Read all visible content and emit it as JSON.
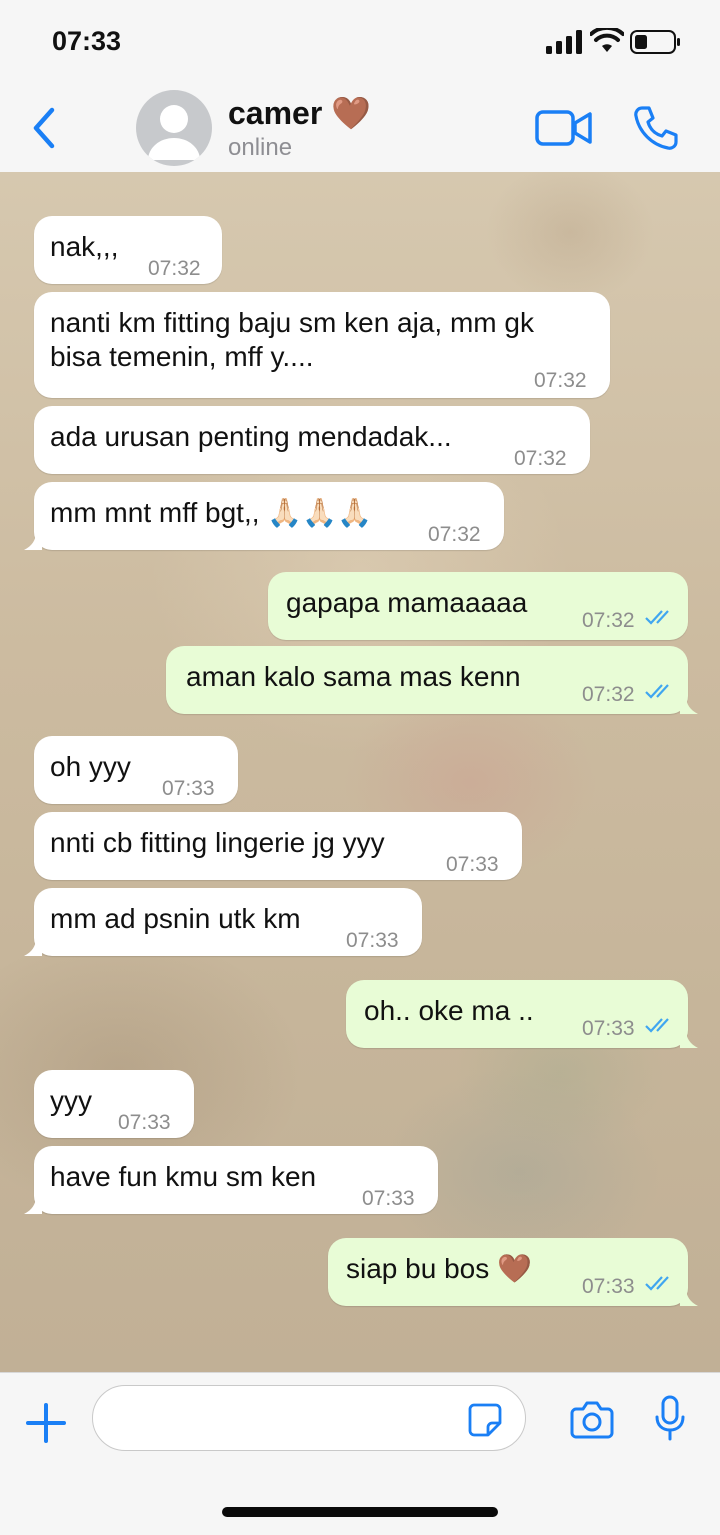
{
  "status_bar": {
    "time": "07:33"
  },
  "header": {
    "name": "camer 🤎",
    "status": "online"
  },
  "messages": [
    {
      "text": "nak,,,",
      "time": "07:32"
    },
    {
      "text": "nanti km fitting baju sm ken aja, mm gk\nbisa temenin, mff y....",
      "time": "07:32"
    },
    {
      "text": "ada urusan penting mendadak...",
      "time": "07:32"
    },
    {
      "text": "mm mnt mff bgt,, 🙏🏻🙏🏻🙏🏻",
      "time": "07:32"
    },
    {
      "text": "gapapa mamaaaaa",
      "time": "07:32"
    },
    {
      "text": "aman kalo sama mas kenn",
      "time": "07:32"
    },
    {
      "text": "oh yyy",
      "time": "07:33"
    },
    {
      "text": "nnti cb fitting lingerie jg yyy",
      "time": "07:33"
    },
    {
      "text": "mm ad psnin utk km",
      "time": "07:33"
    },
    {
      "text": "oh.. oke ma ..",
      "time": "07:33"
    },
    {
      "text": "yyy",
      "time": "07:33"
    },
    {
      "text": "have fun kmu sm ken",
      "time": "07:33"
    },
    {
      "text": "siap bu bos 🤎",
      "time": "07:33"
    }
  ],
  "colors": {
    "accent": "#1a7ff5",
    "incoming_bubble": "#ffffff",
    "outgoing_bubble": "#e8fcd6",
    "read_ticks": "#40a6f0"
  },
  "icons": [
    "back-icon",
    "avatar-icon",
    "video-call-icon",
    "phone-icon",
    "plus-icon",
    "sticker-icon",
    "camera-icon",
    "microphone-icon",
    "read-ticks-icon"
  ],
  "input": {
    "placeholder": ""
  }
}
